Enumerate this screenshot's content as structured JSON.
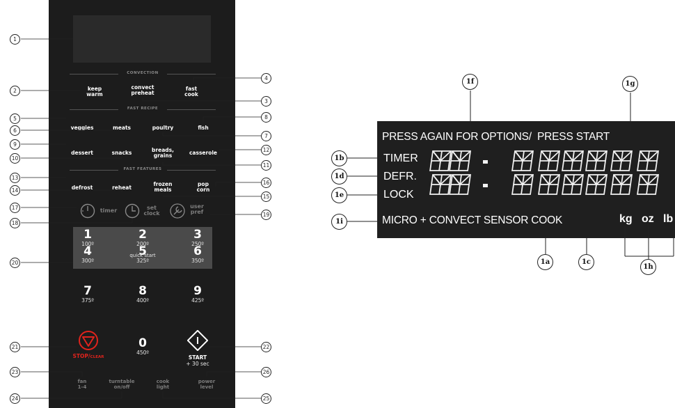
{
  "panel": {
    "sections": {
      "convection": "CONVECTION",
      "fast_recipe": "FAST RECIPE",
      "fast_features": "FAST FEATURES"
    },
    "buttons": {
      "keep_warm": "keep\nwarm",
      "convect_preheat": "convect\npreheat",
      "fast_cook": "fast\ncook",
      "veggies": "veggies",
      "meats": "meats",
      "poultry": "poultry",
      "fish": "fish",
      "dessert": "dessert",
      "snacks": "snacks",
      "breads_grains": "breads,\ngrains",
      "casserole": "casserole",
      "defrost": "defrost",
      "reheat": "reheat",
      "frozen_meals": "frozen\nmeals",
      "pop_corn": "pop\ncorn",
      "timer": "timer",
      "set_clock": "set\nclock",
      "user_pref": "user\npref",
      "stop": "STOP/",
      "clear": "CLEAR",
      "start": "START",
      "start_sub": "+ 30 sec",
      "fan": "fan\n1-4",
      "turntable": "turntable\non/off",
      "cook_light": "cook\nlight",
      "power_level": "power\nlevel"
    },
    "keypad": {
      "quick_start": "quick start",
      "keys": [
        {
          "n": "1",
          "t": "100º"
        },
        {
          "n": "2",
          "t": "200º"
        },
        {
          "n": "3",
          "t": "250º"
        },
        {
          "n": "4",
          "t": "300º"
        },
        {
          "n": "5",
          "t": "325º"
        },
        {
          "n": "6",
          "t": "350º"
        },
        {
          "n": "7",
          "t": "375º"
        },
        {
          "n": "8",
          "t": "400º"
        },
        {
          "n": "9",
          "t": "425º"
        },
        {
          "n": "0",
          "t": "450º"
        }
      ]
    },
    "callouts": [
      "1",
      "2",
      "3",
      "4",
      "5",
      "6",
      "7",
      "8",
      "9",
      "10",
      "11",
      "12",
      "13",
      "14",
      "15",
      "16",
      "17",
      "18",
      "19",
      "20",
      "21",
      "22",
      "23",
      "24",
      "25",
      "26"
    ]
  },
  "display": {
    "top_line": "PRESS AGAIN FOR OPTIONS/  PRESS START",
    "timer": "TIMER",
    "defr": "DEFR.",
    "lock": "LOCK",
    "bottom_line": "MICRO + CONVECT SENSOR COOK",
    "units": {
      "kg": "kg",
      "oz": "oz",
      "lb": "lb"
    },
    "callouts": {
      "1a": "1a",
      "1b": "1b",
      "1c": "1c",
      "1d": "1d",
      "1e": "1e",
      "1f": "1f",
      "1g": "1g",
      "1h": "1h",
      "1i": "1i"
    }
  },
  "colors": {
    "panel": "#1c1c1c",
    "stop_red": "#e0231c",
    "lcd_bg": "#1f1f1f",
    "segment_on": "#f2f2f2"
  }
}
